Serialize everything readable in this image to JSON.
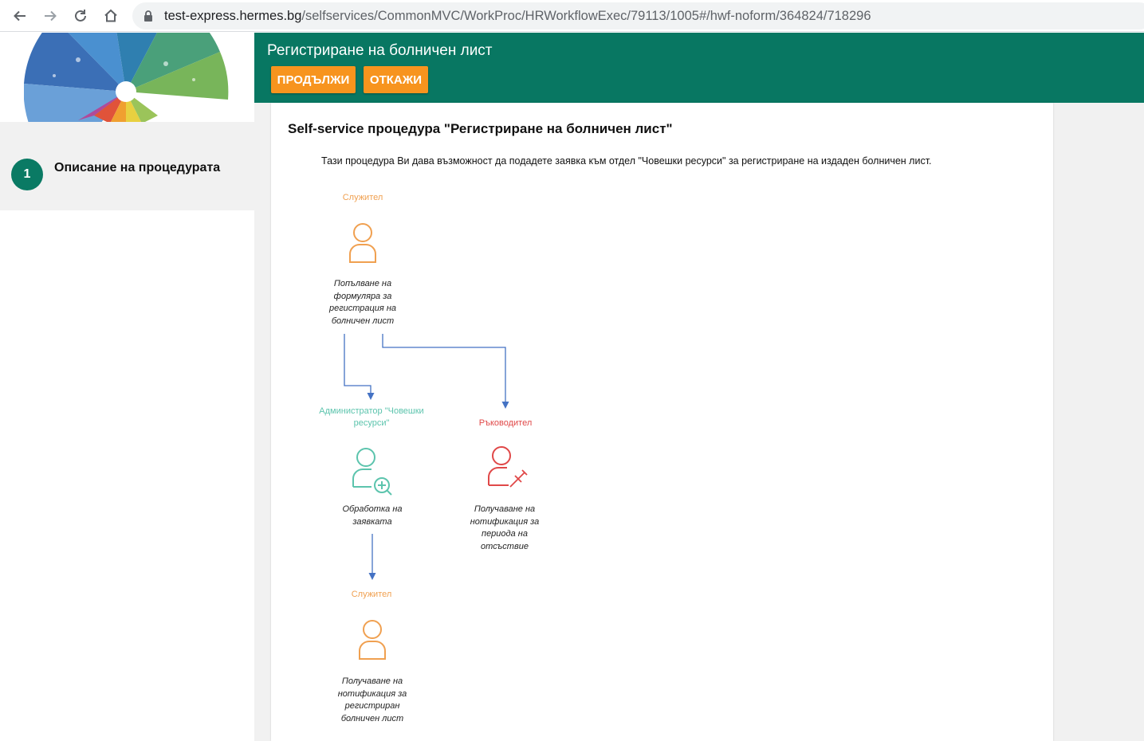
{
  "browser": {
    "url_host": "test-express.hermes.bg",
    "url_path": "/selfservices/CommonMVC/WorkProc/HRWorkflowExec/79113/1005#/hwf-noform/364824/718296"
  },
  "sidebar": {
    "steps": [
      {
        "number": "1",
        "label": "Описание на процедурата"
      }
    ]
  },
  "header": {
    "title": "Регистриране на болничен лист",
    "continue_label": "ПРОДЪЛЖИ",
    "cancel_label": "ОТКАЖИ"
  },
  "content": {
    "title": "Self-service процедура \"Регистриране на болничен лист\"",
    "description": "Тази процедура Ви дава възможност да подадете заявка към отдел \"Човешки ресурси\" за регистриране на издаден болничен лист."
  },
  "diagram": {
    "nodes": [
      {
        "role": "Служител",
        "caption": "Попълване на формуляра за регистрация на болничен лист",
        "color": "#f0a050"
      },
      {
        "role": "Администратор \"Човешки ресурси\"",
        "caption": "Обработка на заявката",
        "color": "#5cc4ad"
      },
      {
        "role": "Ръководител",
        "caption": "Получаване на нотификация за периода на отсъствие",
        "color": "#e04848"
      },
      {
        "role": "Служител",
        "caption": "Получаване на нотификация за регистриран болничен лист",
        "color": "#f0a050"
      }
    ],
    "arrow_color": "#4472c4"
  },
  "colors": {
    "header_green": "#087762",
    "button_orange": "#f7941e",
    "step_circle": "#0a7a64"
  }
}
